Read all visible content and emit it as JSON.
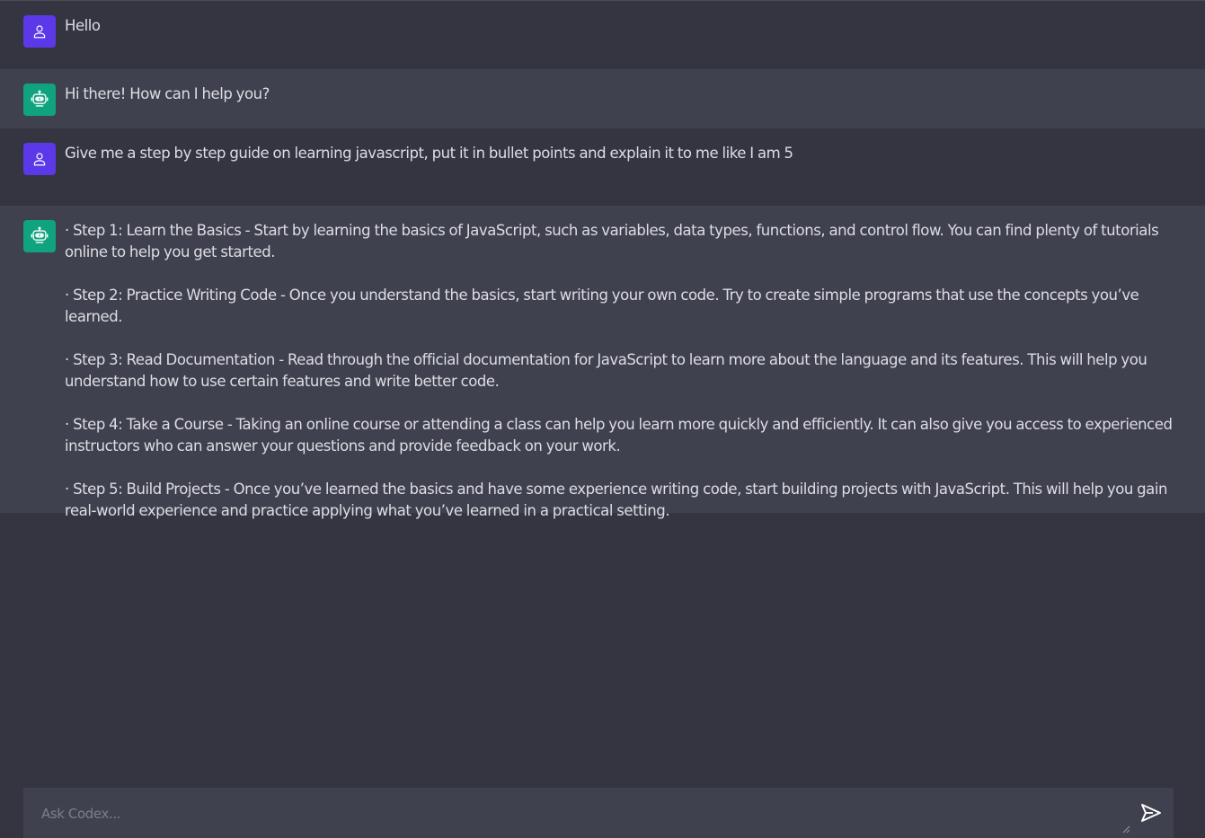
{
  "messages": [
    {
      "role": "user",
      "text": "Hello"
    },
    {
      "role": "bot",
      "text": "Hi there! How can I help you?"
    },
    {
      "role": "user",
      "text": "Give me a step by step guide on learning javascript, put it in bullet points and explain it to me like I am 5"
    },
    {
      "role": "bot",
      "paragraphs": [
        "· Step 1: Learn the Basics - Start by learning the basics of JavaScript, such as variables, data types, functions, and control flow. You can find plenty of tutorials online to help you get started.",
        "· Step 2: Practice Writing Code - Once you understand the basics, start writing your own code. Try to create simple programs that use the concepts you’ve learned.",
        "· Step 3: Read Documentation - Read through the official documentation for JavaScript to learn more about the language and its features. This will help you understand how to use certain features and write better code.",
        "· Step 4: Take a Course - Taking an online course or attending a class can help you learn more quickly and efficiently. It can also give you access to experienced instructors who can answer your questions and provide feedback on your work.",
        "· Step 5: Build Projects - Once you’ve learned the basics and have some experience writing code, start building projects with JavaScript. This will help you gain real-world experience and practice applying what you’ve learned in a practical setting."
      ]
    }
  ],
  "composer": {
    "placeholder": "Ask Codex...",
    "value": ""
  },
  "icons": {
    "user_avatar": "user-icon",
    "bot_avatar": "robot-icon",
    "send": "send-icon"
  },
  "colors": {
    "background": "#343541",
    "bot_row": "#40414f",
    "user_avatar": "#5b38e8",
    "bot_avatar": "#10a37f"
  }
}
